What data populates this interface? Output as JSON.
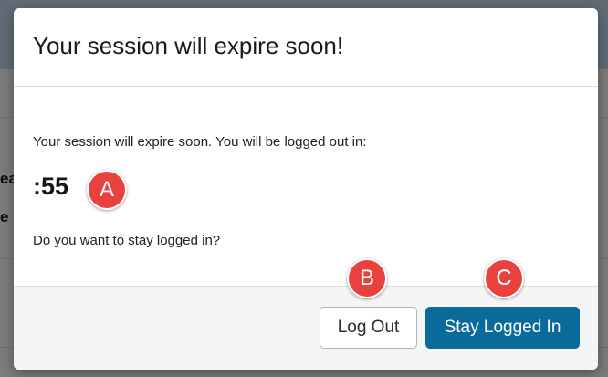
{
  "background": {
    "partial_text": [
      "ea",
      "e"
    ]
  },
  "modal": {
    "title": "Your session will expire soon!",
    "message": "Your session will expire soon. You will be logged out in:",
    "countdown": ":55",
    "question": "Do you want to stay logged in?",
    "logout_label": "Log Out",
    "stay_label": "Stay Logged In"
  },
  "markers": [
    "A",
    "B",
    "C"
  ],
  "colors": {
    "primary_button": "#0a6a99",
    "marker": "#e8413e",
    "footer_bg": "#f5f5f5"
  }
}
